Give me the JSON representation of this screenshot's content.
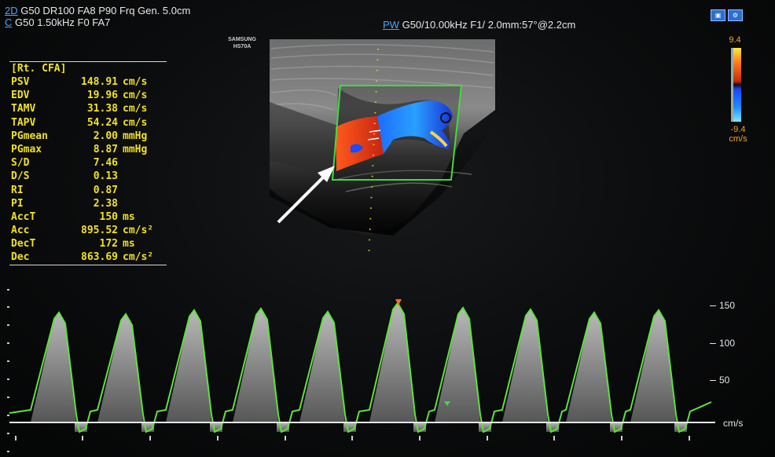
{
  "header": {
    "line1_mode": "2D",
    "line1_text": "G50 DR100 FA8 P90 Frq Gen. 5.0cm",
    "line2_mode": "C",
    "line2_text": "G50 1.50kHz F0 FA7"
  },
  "pw_header": {
    "mode": "PW",
    "text": "G50/10.00kHz F1/ 2.0mm:57°@2.2cm"
  },
  "brand": {
    "line1": "SAMSUNG",
    "line2": "HS70A"
  },
  "measurements": {
    "title": "[Rt. CFA]",
    "rows": [
      {
        "label": "PSV",
        "value": "148.91",
        "unit": "cm/s"
      },
      {
        "label": "EDV",
        "value": "19.96",
        "unit": "cm/s"
      },
      {
        "label": "TAMV",
        "value": "31.38",
        "unit": "cm/s"
      },
      {
        "label": "TAPV",
        "value": "54.24",
        "unit": "cm/s"
      },
      {
        "label": "PGmean",
        "value": "2.00",
        "unit": "mmHg"
      },
      {
        "label": "PGmax",
        "value": "8.87",
        "unit": "mmHg"
      },
      {
        "label": "S/D",
        "value": "7.46",
        "unit": ""
      },
      {
        "label": "D/S",
        "value": "0.13",
        "unit": ""
      },
      {
        "label": "RI",
        "value": "0.87",
        "unit": ""
      },
      {
        "label": "PI",
        "value": "2.38",
        "unit": ""
      },
      {
        "label": "AccT",
        "value": "150",
        "unit": "ms"
      },
      {
        "label": "Acc",
        "value": "895.52",
        "unit": "cm/s²"
      },
      {
        "label": "DecT",
        "value": "172",
        "unit": "ms"
      },
      {
        "label": "Dec",
        "value": "863.69",
        "unit": "cm/s²"
      }
    ]
  },
  "color_bar": {
    "top": "9.4",
    "bottom": "-9.4",
    "unit": "cm/s"
  },
  "velocity_scale": {
    "ticks": [
      "150",
      "100",
      "50"
    ],
    "unit": "cm/s"
  },
  "colors": {
    "trace": "#5fe33c",
    "box": "#3fdc3f",
    "text_yellow": "#f2e21c",
    "color_bar_label": "#f3a52a",
    "mode_blue": "#4aa3ff"
  }
}
